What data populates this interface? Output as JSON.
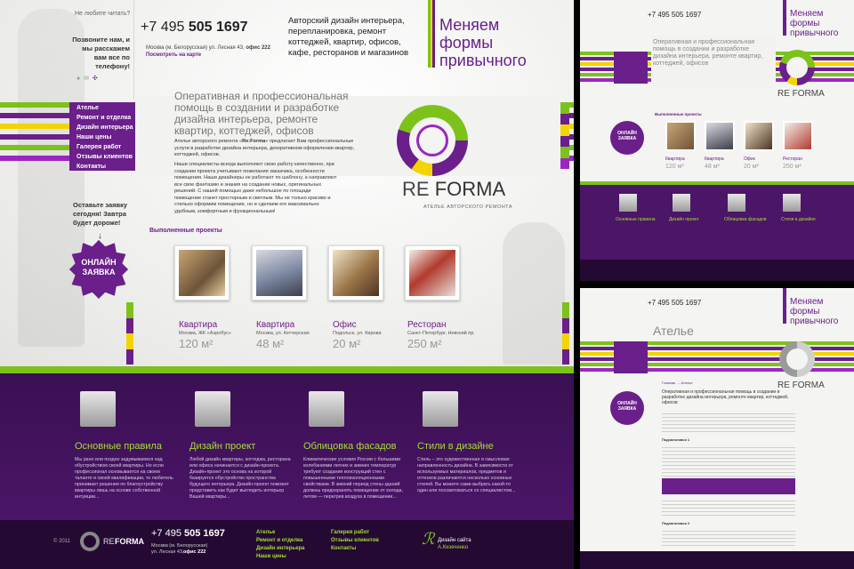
{
  "colors": {
    "purple": "#6a1f8a",
    "green": "#7cc21a",
    "yellow": "#f2d500",
    "dark": "#2b0f3c"
  },
  "main": {
    "top_left_question": "Не любите читать?",
    "top_left_call": "Позвоните нам, и мы расскажем вам все по телефону!",
    "phone_prefix": "+7 495",
    "phone_number": "505 1697",
    "address": "Москва (м. Белорусская) ул. Лесная 43,",
    "office": "офис 222",
    "map_link": "Посмотреть на карте",
    "services": "Авторский дизайн интерьера, перепланировка, ремонт коттеджей, квартир, офисов, кафе, ресторанов и магазинов",
    "slogan": "Меняем формы привычного",
    "headline": "Оперативная и профессиональная помощь в создании и разработке дизайна интерьера, ремонте квартир, коттеджей, офисов",
    "para1_a": "Ателье авторского ремонта «",
    "para1_brand": "Re:Forma",
    "para1_b": "» предлагает Вам профессиональные услуги в разработке дизайна интерьера, декоративном оформлении квартир, коттеджей, офисов.",
    "para2": "Наши специалисты всегда выполняют свою работу качественно, при создании проекта учитывают пожелания заказчика, особенности помещения. Наши дизайнеры не работают по шаблону, а направляют все свое фантазию и знания на создание новых, оригинальных решений. С нашей помощью даже небольшое по площади помещение станет просторным и светлым. Мы не только красиво и стильно оформим помещение, но и сделаем его максимально удобным, комфортным и функциональным!",
    "logo_re": "RE",
    "logo_forma": "FORMA",
    "logo_sub": "АТЕЛЬЕ АВТОРСКОГО РЕМОНТА",
    "nav": [
      "Ателье",
      "Ремонт и отделка",
      "Дизайн интерьера",
      "Наши цены",
      "Галерея работ",
      "Отзывы клиентов",
      "Контакты"
    ],
    "request_text": "Оставьте заявку сегодня! Завтра будет дороже!",
    "online_btn": "ОНЛАЙН ЗАЯВКА",
    "projects_title": "Выполненные проекты",
    "projects": [
      {
        "name": "Квартира",
        "place": "Москва, ЖК «Аэробус»",
        "area": "120 м²"
      },
      {
        "name": "Квартира",
        "place": "Москва, ул. Кетчерская",
        "area": "48 м²"
      },
      {
        "name": "Офис",
        "place": "Подольск, ул. Кирова",
        "area": "20 м²"
      },
      {
        "name": "Ресторан",
        "place": "Санкт-Петербург, Невский пр.",
        "area": "250 м²"
      }
    ],
    "features": [
      {
        "title": "Основные правила",
        "text": "Мы рано или поздно задумываемся над обустройством своей квартиры. Но если профессионал основывается на своем таланте и своей квалификации, то любитель принимает решения по благоустройству квартиры лишь на основе собственной интуиции..."
      },
      {
        "title": "Дизайн проект",
        "text": "Любой дизайн квартиры, коттеджа, ресторана или офиса начинается с дизайн-проекта. Дизайн-проект это основа на которой базируется обустройство пространства будущего интерьера. Дизайн-проект поможет представить как будет выглядеть интерьер Вашей квартиры..."
      },
      {
        "title": "Облицовка фасадов",
        "text": "Климатические условия России с большими колебаниями летних и зимних температур требуют создания конструкций стен с повышенными теплоизоляционными свойствами. В зимний период стены зданий должны предохранять помещение от холода, летом — перегрев воздуха в помещении..."
      },
      {
        "title": "Стили в дизайне",
        "text": "Стиль – это художественная и смысловая направленность дизайна. В зависимости от используемых материалов, предметов и оттенков различаются несколько основных стилей. Вы можете сами выбрать какой-то один или посоветоваться со специалистом..."
      }
    ],
    "footer": {
      "copyright": "© 2011",
      "phone_prefix": "+7 495",
      "phone_number": "505 1697",
      "address": "Москва (м. Белорусская) ул. Лесная 43,",
      "office": "офис 222",
      "col1": [
        "Ателье",
        "Ремонт и отделка",
        "Дизайн интерьера",
        "Наши цены"
      ],
      "col2": [
        "Галерея работ",
        "Отзывы клиентов",
        "Контакты"
      ],
      "credit_label": "Дизайн сайта",
      "credit_name": "А.Кизеченко"
    }
  },
  "thumb_top": {
    "phone": "+7 495 505 1697",
    "slogan": "Меняем формы привычного",
    "headline": "Оперативная и профессиональная помощь в создании и разработке дизайна интерьера, ремонте квартир, коттеджей, офисов",
    "projects_title": "Выполненные проекты",
    "projects": [
      {
        "name": "Квартира",
        "area": "120 м²"
      },
      {
        "name": "Квартира",
        "area": "48 м²"
      },
      {
        "name": "Офис",
        "area": "20 м²"
      },
      {
        "name": "Ресторан",
        "area": "250 м²"
      }
    ],
    "features": [
      "Основные правила",
      "Дизайн проект",
      "Облицовка фасадов",
      "Стили в дизайне"
    ],
    "online_btn": "ОНЛАЙН ЗАЯВКА",
    "logo": "RE FORMA"
  },
  "thumb_bottom": {
    "phone": "+7 495 505 1697",
    "slogan": "Меняем формы привычного",
    "section_title": "Ателье",
    "breadcrumb": "Главная → Ателье",
    "headline": "Оперативная и профессиональная помощь в создании и разработке дизайна интерьера, ремонте квартир, коттеджей, офисов",
    "subheading1": "Подзаголовок 1",
    "subheading2": "Подзаголовок 2",
    "online_btn": "ОНЛАЙН ЗАЯВКА",
    "logo": "RE FORMA"
  }
}
